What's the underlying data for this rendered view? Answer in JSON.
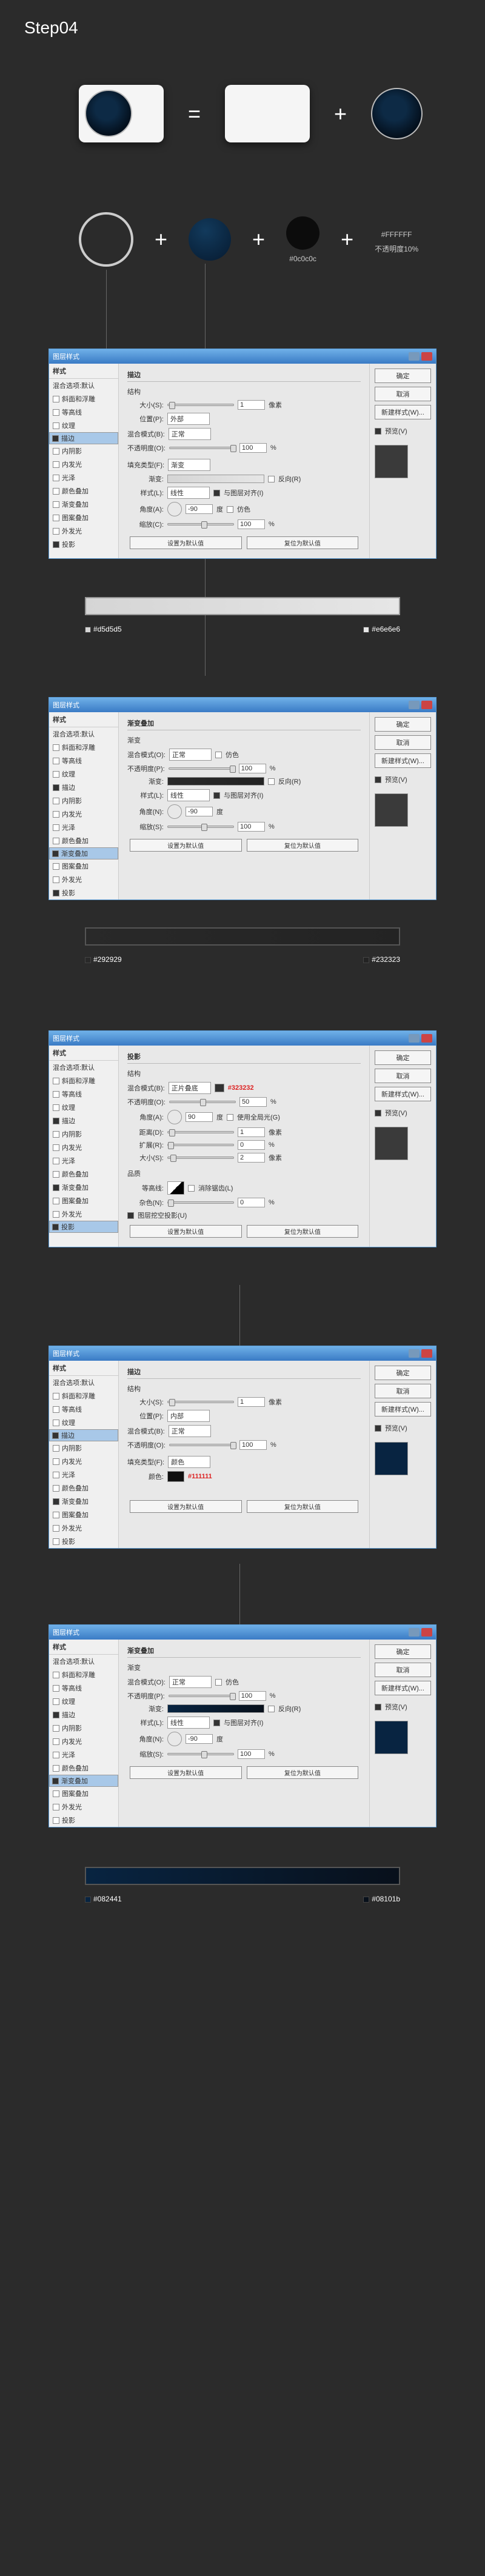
{
  "step": "Step04",
  "ops": {
    "eq": "=",
    "plus": "+"
  },
  "colors": {
    "black_disc": "#0c0c0c",
    "white_label": "#FFFFFF",
    "white_opacity": "不透明度10%",
    "swatch1_left": "#d5d5d5",
    "swatch1_right": "#e6e6e6",
    "swatch2_left": "#292929",
    "swatch2_right": "#232323",
    "red1": "#323232",
    "red2": "#111111",
    "swatch3_left": "#082441",
    "swatch3_right": "#08101b"
  },
  "dlg": {
    "title": "图层样式",
    "side_head": "样式",
    "items": [
      "混合选项:默认",
      "斜面和浮雕",
      "等高线",
      "纹理",
      "描边",
      "内阴影",
      "内发光",
      "光泽",
      "颜色叠加",
      "渐变叠加",
      "图案叠加",
      "外发光",
      "投影"
    ],
    "ok": "确定",
    "cancel": "取消",
    "new_style": "新建样式(W)...",
    "preview": "预览(V)",
    "defaults_btn": "设置为默认值",
    "reset_btn": "复位为默认值"
  },
  "stroke": {
    "title": "描边",
    "struct": "结构",
    "size": "大小(S):",
    "size_val": "1",
    "px": "像素",
    "pos": "位置(P):",
    "pos_val": "外部",
    "blend": "混合模式(B):",
    "blend_val": "正常",
    "opacity": "不透明度(O):",
    "opacity_val": "100",
    "pct": "%",
    "fill_type": "填充类型(F):",
    "fill_type_val": "渐变",
    "grad": "渐变:",
    "reverse": "反向(R)",
    "style": "样式(L):",
    "style_val": "线性",
    "align": "与图层对齐(I)",
    "angle": "角度(A):",
    "angle_val": "-90",
    "deg": "度",
    "scale": "缩放(C):",
    "scale_val": "100"
  },
  "gradov": {
    "title": "渐变叠加",
    "grad_head": "渐变",
    "blend": "混合模式(O):",
    "blend_val": "正常",
    "dither": "仿色",
    "opacity": "不透明度(P):",
    "opacity_val": "100",
    "grad": "渐变:",
    "reverse": "反向(R)",
    "style": "样式(L):",
    "style_val": "线性",
    "align": "与图层对齐(I)",
    "angle": "角度(N):",
    "angle_val": "-90",
    "deg": "度",
    "scale": "缩放(S):",
    "scale_val": "100"
  },
  "drop": {
    "title": "投影",
    "struct": "结构",
    "blend": "混合模式(B):",
    "blend_val": "正片叠底",
    "opacity": "不透明度(O):",
    "opacity_val": "50",
    "angle": "角度(A):",
    "angle_val": "90",
    "deg": "度",
    "global": "使用全局光(G)",
    "distance": "距离(D):",
    "distance_val": "1",
    "px": "像素",
    "spread": "扩展(R):",
    "spread_val": "0",
    "pct": "%",
    "size": "大小(S):",
    "size_val": "2",
    "quality": "品质",
    "contour": "等高线:",
    "anti": "消除锯齿(L)",
    "noise": "杂色(N):",
    "noise_val": "0",
    "knockout": "图层挖空投影(U)"
  },
  "stroke2": {
    "title": "描边",
    "struct": "结构",
    "size": "大小(S):",
    "size_val": "1",
    "px": "像素",
    "pos": "位置(P):",
    "内部": "内部",
    "blend": "混合模式(B):",
    "blend_val": "正常",
    "opacity": "不透明度(O):",
    "opacity_val": "100",
    "fill_type": "填充类型(F):",
    "fill_type_val": "颜色",
    "color": "颜色:"
  }
}
